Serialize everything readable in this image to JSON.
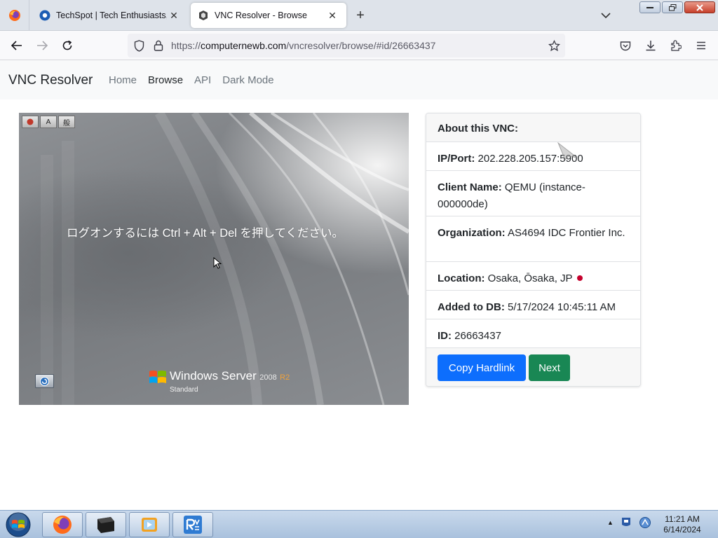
{
  "browser": {
    "tabs": [
      {
        "title": "TechSpot | Tech Enthusiasts, Po",
        "icon": "techspot-favicon",
        "active": false
      },
      {
        "title": "VNC Resolver - Browse",
        "icon": "vnc-resolver-favicon",
        "active": true
      }
    ],
    "url": {
      "prefix": "https://",
      "host": "computernewb.com",
      "path": "/vncresolver/browse/#id/26663437"
    },
    "window_controls": [
      "minimize",
      "restore",
      "close"
    ]
  },
  "site": {
    "brand": "VNC Resolver",
    "nav": [
      "Home",
      "Browse",
      "API",
      "Dark Mode"
    ],
    "active_nav": "Browse"
  },
  "screenshot": {
    "toolbar_buttons": [
      "",
      "A",
      "般"
    ],
    "message": "ログオンするには Ctrl + Alt + Del を押してください。",
    "os_brand": "Windows Server",
    "os_version": "2008",
    "os_version_suffix": "R2",
    "os_edition": "Standard"
  },
  "info": {
    "header": "About this VNC:",
    "ip_label": "IP/Port:",
    "ip_value": "202.228.205.157:5900",
    "client_label": "Client Name:",
    "client_value": "QEMU (instance-000000de)",
    "org_label": "Organization:",
    "org_value": "AS4694 IDC Frontier Inc.",
    "location_label": "Location:",
    "location_value": "Osaka, Ōsaka, JP",
    "added_label": "Added to DB:",
    "added_value": "5/17/2024 10:45:11 AM",
    "id_label": "ID:",
    "id_value": "26663437",
    "copy_button": "Copy Hardlink",
    "next_button": "Next"
  },
  "taskbar": {
    "items": [
      "firefox",
      "terminal",
      "media-player",
      "vnc-viewer"
    ],
    "time": "11:21 AM",
    "date": "6/14/2024"
  },
  "colors": {
    "primary": "#0d6efd",
    "success": "#198754",
    "location_dot": "#c5002c"
  }
}
